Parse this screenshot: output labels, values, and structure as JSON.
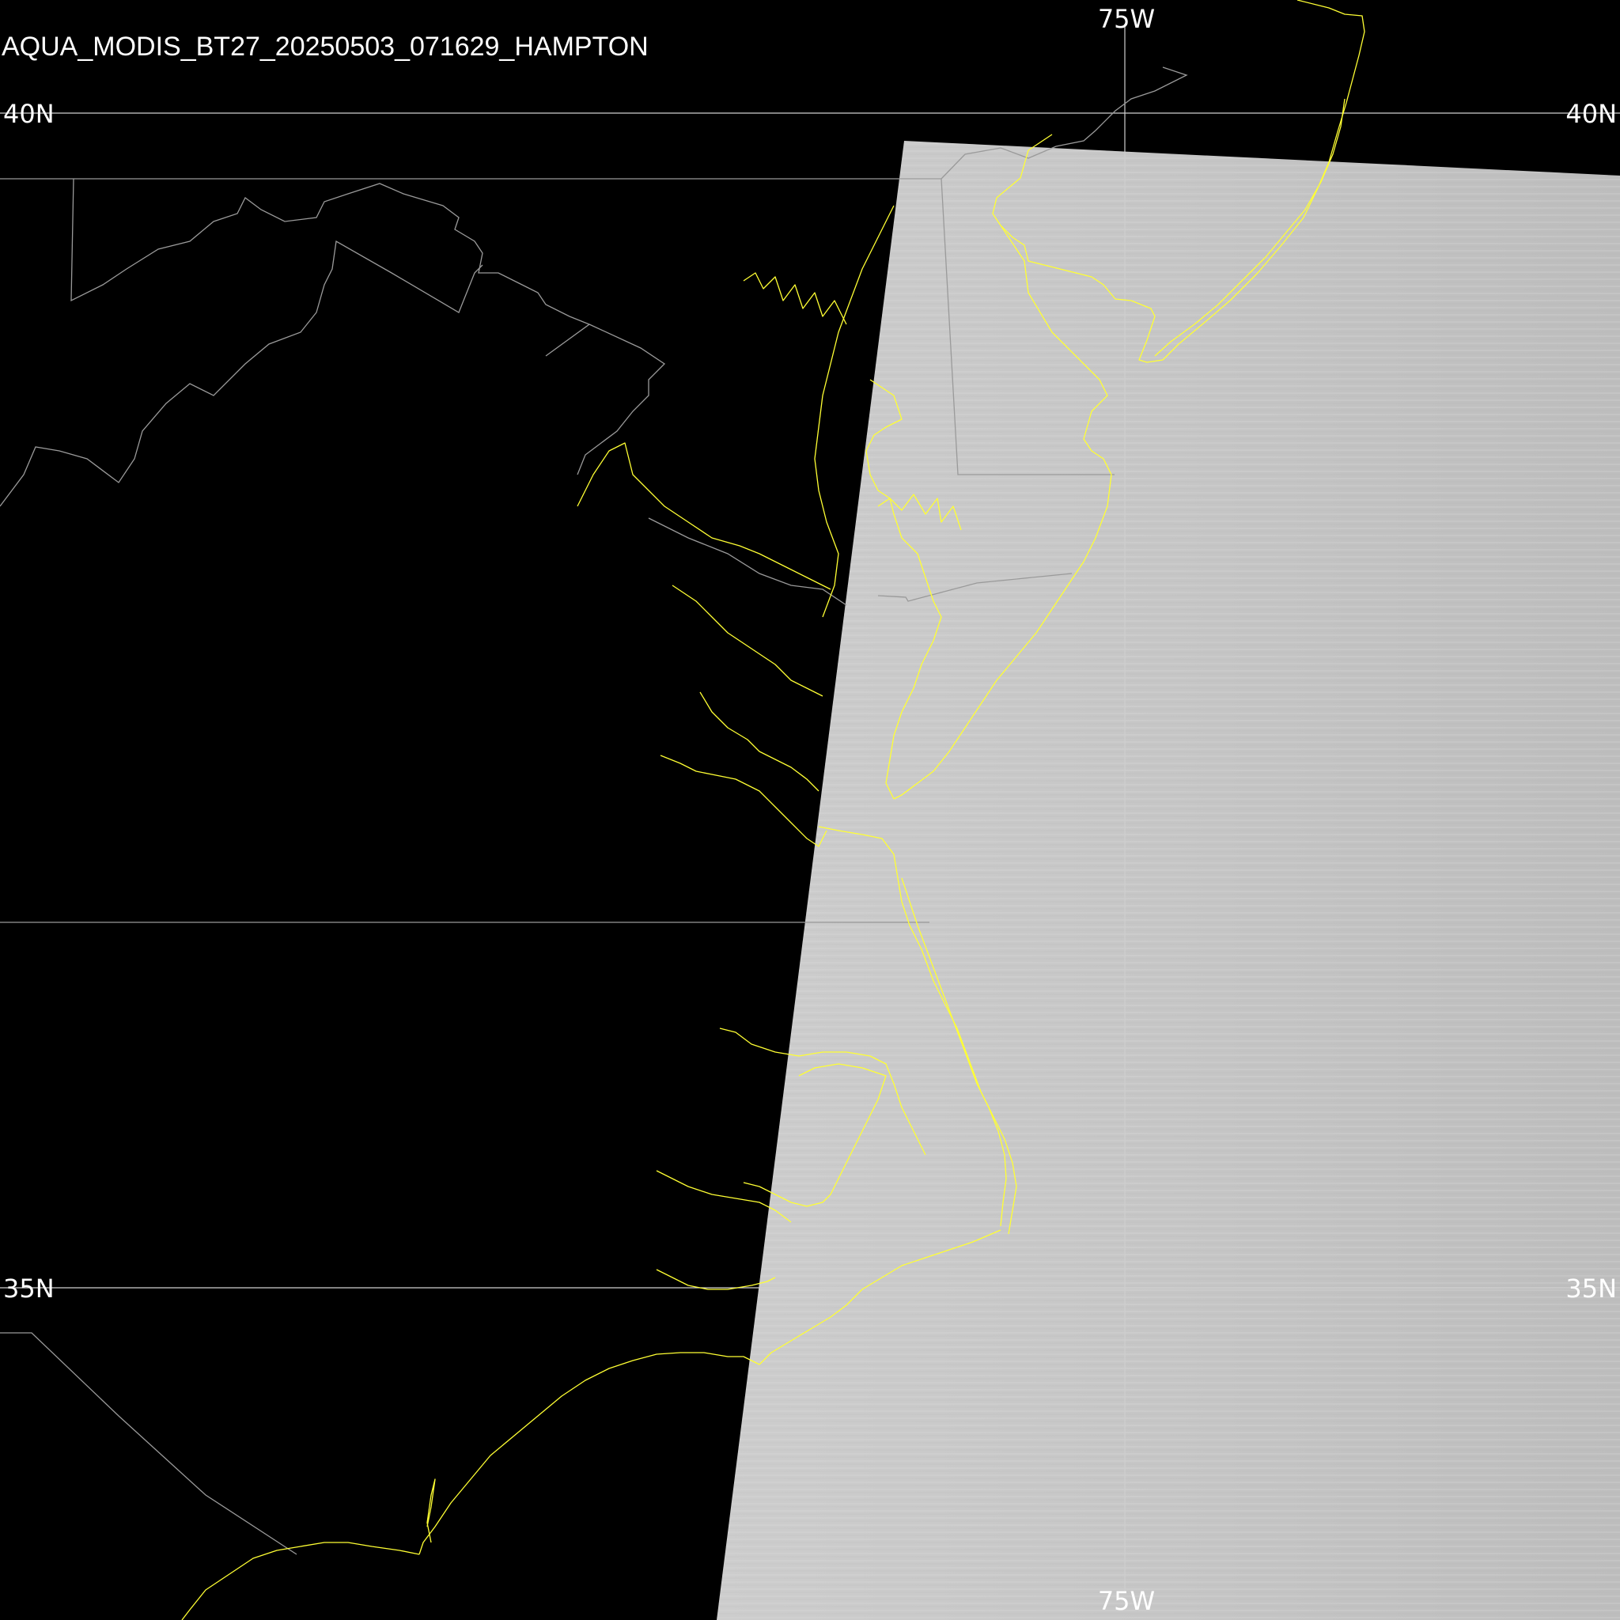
{
  "title": "AQUA_MODIS_BT27_20250503_071629_HAMPTON",
  "graticule": {
    "lat_top": "40N",
    "lat_bottom": "35N",
    "lon": "75W"
  },
  "colors": {
    "background": "#000000",
    "coastline": "#ffff33",
    "boundary": "#9a9a9a",
    "graticule": "#cfcfcf",
    "swath": "#c4c4c4",
    "text": "#ffffff"
  }
}
